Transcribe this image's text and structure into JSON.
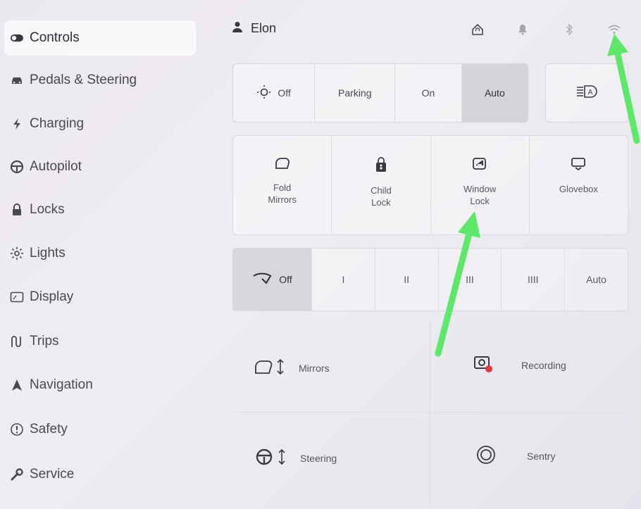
{
  "sidebar": {
    "items": [
      {
        "label": "Controls",
        "icon": "toggle-icon"
      },
      {
        "label": "Pedals & Steering",
        "icon": "car-icon"
      },
      {
        "label": "Charging",
        "icon": "bolt-icon"
      },
      {
        "label": "Autopilot",
        "icon": "steering-wheel-icon"
      },
      {
        "label": "Locks",
        "icon": "lock-icon"
      },
      {
        "label": "Lights",
        "icon": "sun-icon"
      },
      {
        "label": "Display",
        "icon": "display-icon"
      },
      {
        "label": "Trips",
        "icon": "trips-icon"
      },
      {
        "label": "Navigation",
        "icon": "navigation-icon"
      },
      {
        "label": "Safety",
        "icon": "safety-icon"
      },
      {
        "label": "Service",
        "icon": "wrench-icon"
      }
    ]
  },
  "header": {
    "user_name": "Elon",
    "icons": [
      "home-icon",
      "bell-icon",
      "bluetooth-icon",
      "wifi-icon"
    ]
  },
  "lights": {
    "options": [
      "Off",
      "Parking",
      "On",
      "Auto"
    ],
    "selected": "Auto"
  },
  "quick_controls": [
    {
      "label": "Fold\nMirrors",
      "icon": "mirror-icon"
    },
    {
      "label": "Child\nLock",
      "icon": "child-lock-icon"
    },
    {
      "label": "Window\nLock",
      "icon": "window-lock-icon"
    },
    {
      "label": "Glovebox",
      "icon": "glovebox-icon"
    }
  ],
  "wipers": {
    "off_label": "Off",
    "levels": [
      "I",
      "II",
      "III",
      "IIII"
    ],
    "auto_label": "Auto"
  },
  "adjust": {
    "mirrors_label": "Mirrors",
    "steering_label": "Steering",
    "recording_label": "Recording",
    "sentry_label": "Sentry"
  },
  "colors": {
    "annotation_arrow": "#5ee86a",
    "recording_dot": "#e23a3a"
  }
}
